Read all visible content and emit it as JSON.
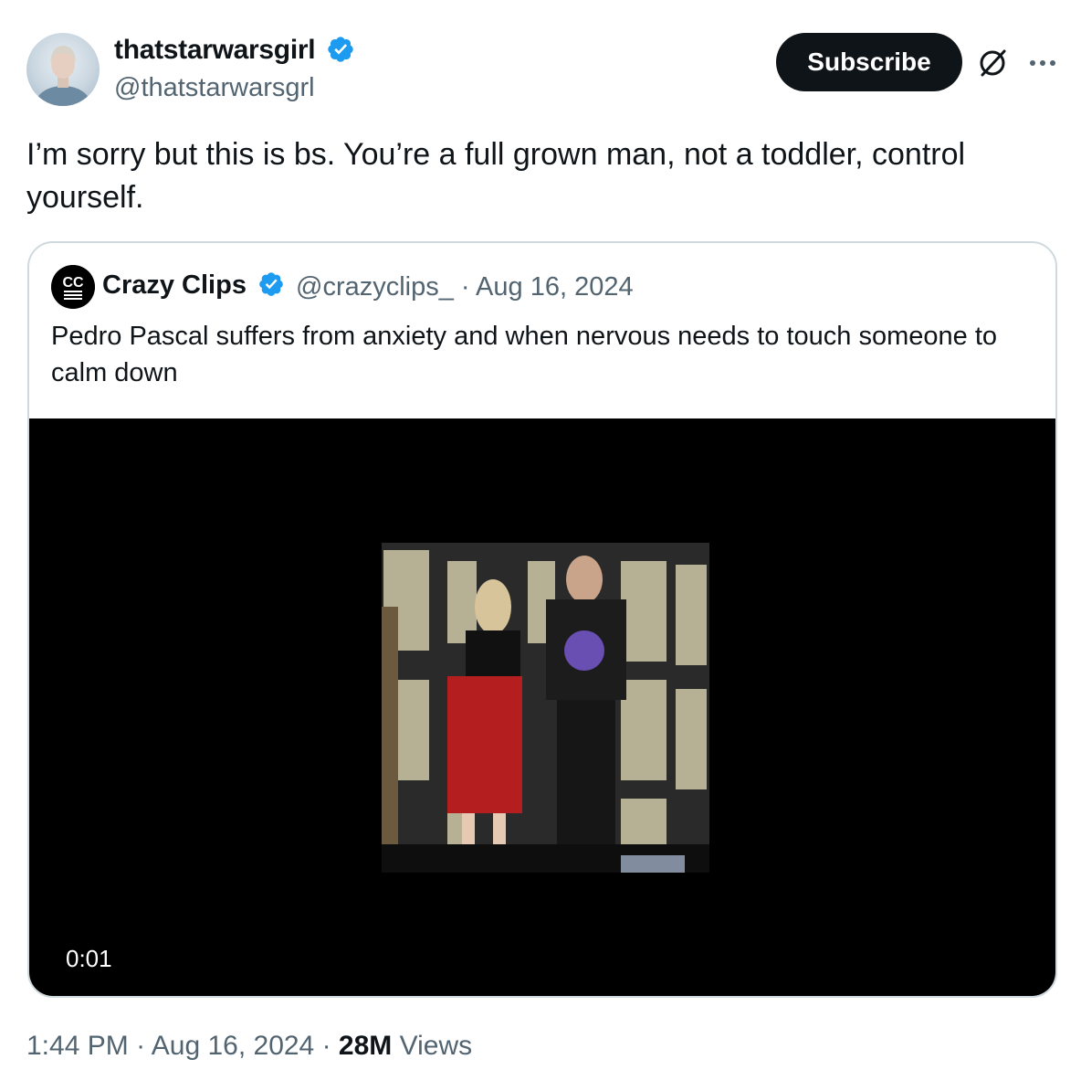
{
  "tweet": {
    "author": {
      "name": "thatstarwarsgirl",
      "handle": "@thatstarwarsgrl",
      "verified": true
    },
    "subscribe_label": "Subscribe",
    "text": "I’m sorry but this is bs. You’re a full grown man, not a toddler, control yourself.",
    "time": "1:44 PM",
    "date": "Aug 16, 2024",
    "views_count": "28M",
    "views_label": "Views",
    "separator": " · "
  },
  "quoted": {
    "avatar_text": "CC",
    "author": {
      "name": "Crazy Clips",
      "handle": "@crazyclips_",
      "verified": true
    },
    "meta": "@crazyclips_ · Aug 16, 2024",
    "text": "Pedro Pascal suffers from anxiety and when nervous needs to touch someone to calm down",
    "video": {
      "timecode": "0:01"
    }
  },
  "colors": {
    "verified": "#1d9bf0",
    "muted": "#536471",
    "primary_text": "#0f1419",
    "border": "#cfd9de"
  },
  "icons": [
    "verified-badge-icon",
    "grok-icon",
    "more-options-icon"
  ]
}
